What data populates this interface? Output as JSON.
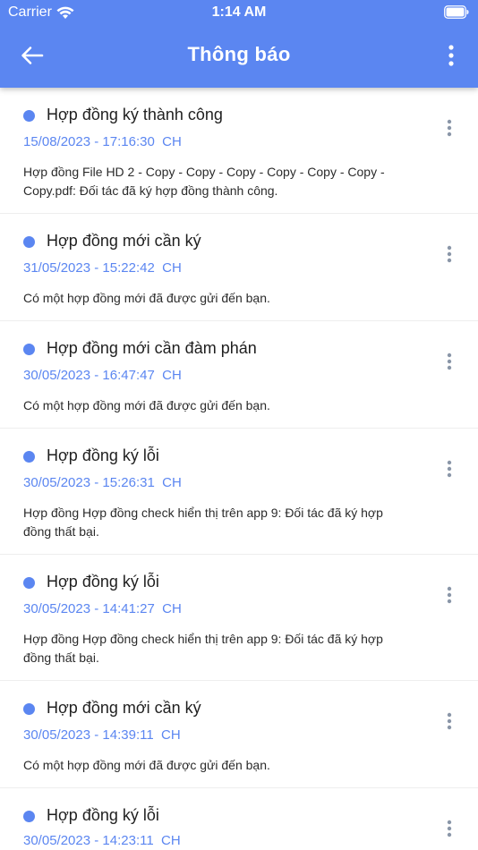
{
  "status_bar": {
    "carrier": "Carrier",
    "time": "1:14 AM"
  },
  "nav": {
    "title": "Thông báo",
    "back_icon": "arrow-left-icon",
    "more_icon": "more-vertical-icon"
  },
  "colors": {
    "accent": "#5b86f1",
    "background": "#ffffff",
    "divider": "#eeeeee"
  },
  "notifications": [
    {
      "title": "Hợp đồng ký thành công",
      "date": "15/08/2023 - 17:16:30  CH",
      "body": "Hợp đồng File HD 2 - Copy - Copy - Copy - Copy - Copy - Copy - Copy.pdf: Đối tác đã ký hợp đồng thành công."
    },
    {
      "title": "Hợp đồng mới cần ký",
      "date": "31/05/2023 - 15:22:42  CH",
      "body": "Có một hợp đồng mới đã được gửi đến bạn."
    },
    {
      "title": "Hợp đồng mới cần đàm phán",
      "date": "30/05/2023 - 16:47:47  CH",
      "body": "Có một hợp đồng mới đã được gửi đến bạn."
    },
    {
      "title": "Hợp đồng ký lỗi",
      "date": "30/05/2023 - 15:26:31  CH",
      "body": "Hợp đồng Hợp đồng check hiển thị trên app 9: Đối tác đã ký hợp đồng thất bại."
    },
    {
      "title": "Hợp đồng ký lỗi",
      "date": "30/05/2023 - 14:41:27  CH",
      "body": "Hợp đồng Hợp đồng check hiển thị trên app 9: Đối tác đã ký hợp đồng thất bại."
    },
    {
      "title": "Hợp đồng mới cần ký",
      "date": "30/05/2023 - 14:39:11  CH",
      "body": "Có một hợp đồng mới đã được gửi đến bạn."
    },
    {
      "title": "Hợp đồng ký lỗi",
      "date": "30/05/2023 - 14:23:11  CH",
      "body": ""
    }
  ]
}
